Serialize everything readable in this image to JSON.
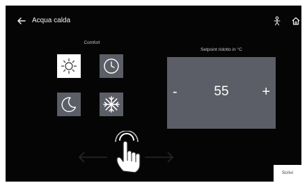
{
  "header": {
    "title": "Acqua calda",
    "icons": [
      "back-arrow-icon",
      "person-icon",
      "home-icon"
    ]
  },
  "comfort": {
    "label": "Comfort",
    "modes": [
      {
        "name": "sun",
        "icon": "sun-icon",
        "selected": true
      },
      {
        "name": "clock",
        "icon": "clock-icon",
        "selected": false
      },
      {
        "name": "moon",
        "icon": "moon-icon",
        "selected": false
      },
      {
        "name": "snow",
        "icon": "snowflake-icon",
        "selected": false
      }
    ]
  },
  "setpoint": {
    "label": "Setpoint ridotto in °C",
    "minus": "-",
    "plus": "+",
    "value": "55"
  },
  "footer": {
    "write_button": "Scrivi"
  },
  "colors": {
    "background": "#050505",
    "tile": "#5b5e66",
    "selected_tile": "#ffffff",
    "text": "#ffffff"
  }
}
